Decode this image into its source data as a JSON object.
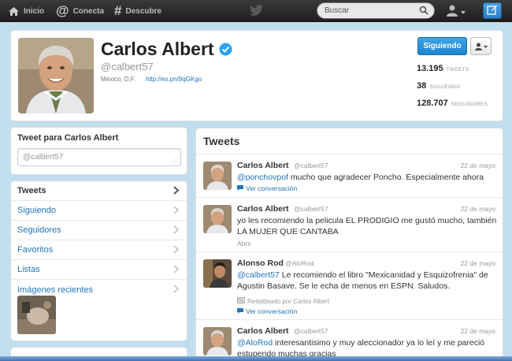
{
  "topbar": {
    "nav": [
      {
        "label": "Inicio",
        "icon": "home-icon"
      },
      {
        "label": "Conecta",
        "icon": "at-icon"
      },
      {
        "label": "Descubre",
        "icon": "hash-icon"
      }
    ],
    "search_placeholder": "Buscar"
  },
  "profile": {
    "name": "Carlos Albert",
    "handle": "@calbert57",
    "location": "México, D.F.",
    "url": "http://es.pn/9qGKgo",
    "follow_label": "Siguiendo",
    "stats": [
      {
        "value": "13.195",
        "label": "TWEETS"
      },
      {
        "value": "38",
        "label": "SIGUIENDO"
      },
      {
        "value": "128.707",
        "label": "SEGUIDORES"
      }
    ]
  },
  "tweetbox": {
    "title": "Tweet para Carlos Albert",
    "value": "@calbert57"
  },
  "sidebar": {
    "items": [
      {
        "label": "Tweets",
        "active": true
      },
      {
        "label": "Siguiendo"
      },
      {
        "label": "Seguidores"
      },
      {
        "label": "Favoritos"
      },
      {
        "label": "Listas"
      },
      {
        "label": "Imágenes recientes"
      }
    ]
  },
  "timeline": {
    "title": "Tweets",
    "tweets": [
      {
        "name": "Carlos Albert",
        "handle": "@calbert57",
        "date": "22 de mayo",
        "mention": "@ponchovpof",
        "text": " mucho que agradecer Poncho. Especialmente ahora",
        "action": "Ver conversación"
      },
      {
        "name": "Carlos Albert",
        "handle": "@calbert57",
        "date": "22 de mayo",
        "mention": "",
        "text": "yo les recomiendo la pelicula EL PRODIGIO me gustó mucho, también LA MUJER QUE CANTABA",
        "action": "Abrir"
      },
      {
        "name": "Alonso Rod",
        "handle": "@AloRod",
        "date": "22 de mayo",
        "mention": "@calbert57",
        "text": " Le recomiendo el libro \"Mexicanidad y Esquizofrenia\" de Agustin Basave. Se le echa de menos en ESPN. Saludos.",
        "retweeted": "Retwitteado por Carlos Albert",
        "action": "Ver conversación"
      },
      {
        "name": "Carlos Albert",
        "handle": "@calbert57",
        "date": "22 de mayo",
        "mention": "@AloRod",
        "text": " interesantisimo y muy aleccionador ya lo leí y me pareció estupendo muchas gracias"
      }
    ]
  },
  "colors": {
    "background": "#c0deed",
    "link": "#2276bb",
    "follow_button": "#1d85d0",
    "topbar": "#2a2a2a"
  }
}
